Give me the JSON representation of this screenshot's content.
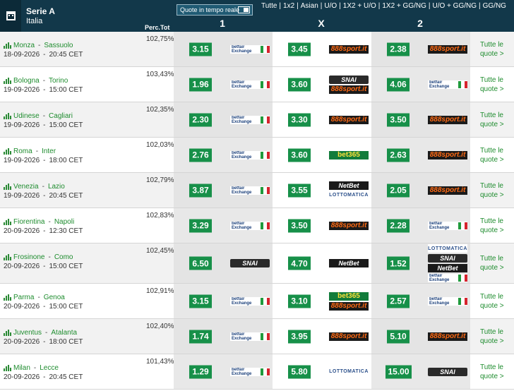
{
  "header": {
    "league": "Serie A",
    "country": "Italia",
    "realtime_label": "Quote in tempo reale",
    "perc_label": "Perc.Tot",
    "col_1": "1",
    "col_x": "X",
    "col_2": "2",
    "markets": [
      "Tutte",
      "1x2",
      "Asian",
      "U/O",
      "1X2 + U/O",
      "1X2 + GG/NG",
      "U/O + GG/NG",
      "GG/NG"
    ]
  },
  "all_quotes_line1": "Tutte le",
  "all_quotes_line2": "quote >",
  "matches": [
    {
      "home": "Monza",
      "away": "Sassuolo",
      "date": "18-09-2026",
      "time": "20:45 CET",
      "perc": "102,75%",
      "o1": "3.15",
      "ox": "3.45",
      "o2": "2.38",
      "b1": [
        "betfair"
      ],
      "bx": [
        "888"
      ],
      "b2": [
        "888"
      ]
    },
    {
      "home": "Bologna",
      "away": "Torino",
      "date": "19-09-2026",
      "time": "15:00 CET",
      "perc": "103,43%",
      "o1": "1.96",
      "ox": "3.60",
      "o2": "4.06",
      "b1": [
        "betfair"
      ],
      "bx": [
        "snai",
        "888"
      ],
      "b2": [
        "betfair"
      ]
    },
    {
      "home": "Udinese",
      "away": "Cagliari",
      "date": "19-09-2026",
      "time": "15:00 CET",
      "perc": "102,35%",
      "o1": "2.30",
      "ox": "3.30",
      "o2": "3.50",
      "b1": [
        "betfair"
      ],
      "bx": [
        "888"
      ],
      "b2": [
        "888"
      ]
    },
    {
      "home": "Roma",
      "away": "Inter",
      "date": "19-09-2026",
      "time": "18:00 CET",
      "perc": "102,03%",
      "o1": "2.76",
      "ox": "3.60",
      "o2": "2.63",
      "b1": [
        "betfair"
      ],
      "bx": [
        "bet365"
      ],
      "b2": [
        "888"
      ]
    },
    {
      "home": "Venezia",
      "away": "Lazio",
      "date": "19-09-2026",
      "time": "20:45 CET",
      "perc": "102,79%",
      "o1": "3.87",
      "ox": "3.55",
      "o2": "2.05",
      "b1": [
        "betfair"
      ],
      "bx": [
        "netbet",
        "lotto"
      ],
      "b2": [
        "888"
      ]
    },
    {
      "home": "Fiorentina",
      "away": "Napoli",
      "date": "20-09-2026",
      "time": "12:30 CET",
      "perc": "102,83%",
      "o1": "3.29",
      "ox": "3.50",
      "o2": "2.28",
      "b1": [
        "betfair"
      ],
      "bx": [
        "888"
      ],
      "b2": [
        "betfair"
      ]
    },
    {
      "home": "Frosinone",
      "away": "Como",
      "date": "20-09-2026",
      "time": "15:00 CET",
      "perc": "102,45%",
      "o1": "6.50",
      "ox": "4.70",
      "o2": "1.52",
      "b1": [
        "snai"
      ],
      "bx": [
        "netbet"
      ],
      "b2": [
        "lotto",
        "snai",
        "netbet",
        "betfair"
      ]
    },
    {
      "home": "Parma",
      "away": "Genoa",
      "date": "20-09-2026",
      "time": "15:00 CET",
      "perc": "102,91%",
      "o1": "3.15",
      "ox": "3.10",
      "o2": "2.57",
      "b1": [
        "betfair"
      ],
      "bx": [
        "bet365",
        "888"
      ],
      "b2": [
        "betfair"
      ]
    },
    {
      "home": "Juventus",
      "away": "Atalanta",
      "date": "20-09-2026",
      "time": "18:00 CET",
      "perc": "102,40%",
      "o1": "1.74",
      "ox": "3.95",
      "o2": "5.10",
      "b1": [
        "betfair"
      ],
      "bx": [
        "888"
      ],
      "b2": [
        "888"
      ]
    },
    {
      "home": "Milan",
      "away": "Lecce",
      "date": "20-09-2026",
      "time": "20:45 CET",
      "perc": "101,43%",
      "o1": "1.29",
      "ox": "5.80",
      "o2": "15.00",
      "b1": [
        "betfair"
      ],
      "bx": [
        "lotto"
      ],
      "b2": [
        "snai"
      ]
    }
  ],
  "bookmakers": {
    "betfair": {
      "line1": "betfair",
      "line2": "Exchange",
      "name": "betfair-exchange"
    },
    "888": {
      "label": "888sport.it",
      "name": "888sport"
    },
    "snai": {
      "label": "SNAI",
      "name": "snai"
    },
    "bet365": {
      "label": "bet365",
      "name": "bet365"
    },
    "netbet": {
      "label": "NetBet",
      "name": "netbet"
    },
    "lotto": {
      "label": "LOTTOMATICA",
      "name": "lottomatica"
    }
  },
  "colors": {
    "header": "#12384a",
    "odds_green": "#179049",
    "team_green": "#1e8c2e"
  }
}
